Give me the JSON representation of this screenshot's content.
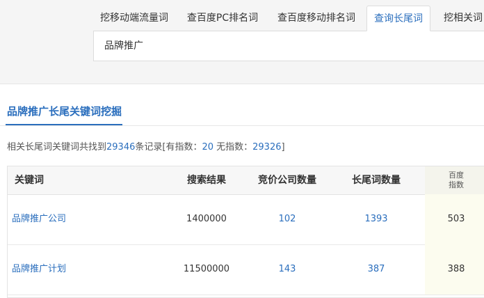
{
  "tabs": [
    {
      "label": "挖移动端流量词"
    },
    {
      "label": "查百度PC排名词"
    },
    {
      "label": "查百度移动排名词"
    },
    {
      "label": "查询长尾词"
    },
    {
      "label": "挖相关词"
    }
  ],
  "active_tab": "查询长尾词",
  "search": {
    "value": "品牌推广"
  },
  "section": {
    "title": "品牌推广长尾关键词挖掘"
  },
  "summary": {
    "prefix": "相关长尾词关键词共找到",
    "total": "29346",
    "mid1": "条记录[有指数：",
    "with_index": "20",
    "mid2": " 无指数：",
    "without_index": "29326",
    "suffix": "]"
  },
  "table": {
    "headers": {
      "keyword": "关键词",
      "results": "搜索结果",
      "bidding": "竞价公司数量",
      "longtail": "长尾词数量",
      "index_line1": "百度",
      "index_line2": "指数"
    },
    "rows": [
      {
        "keyword": "品牌推广公司",
        "results": "1400000",
        "bidding": "102",
        "longtail": "1393",
        "index": "503"
      },
      {
        "keyword": "品牌推广计划",
        "results": "11500000",
        "bidding": "143",
        "longtail": "387",
        "index": "388"
      }
    ]
  }
}
